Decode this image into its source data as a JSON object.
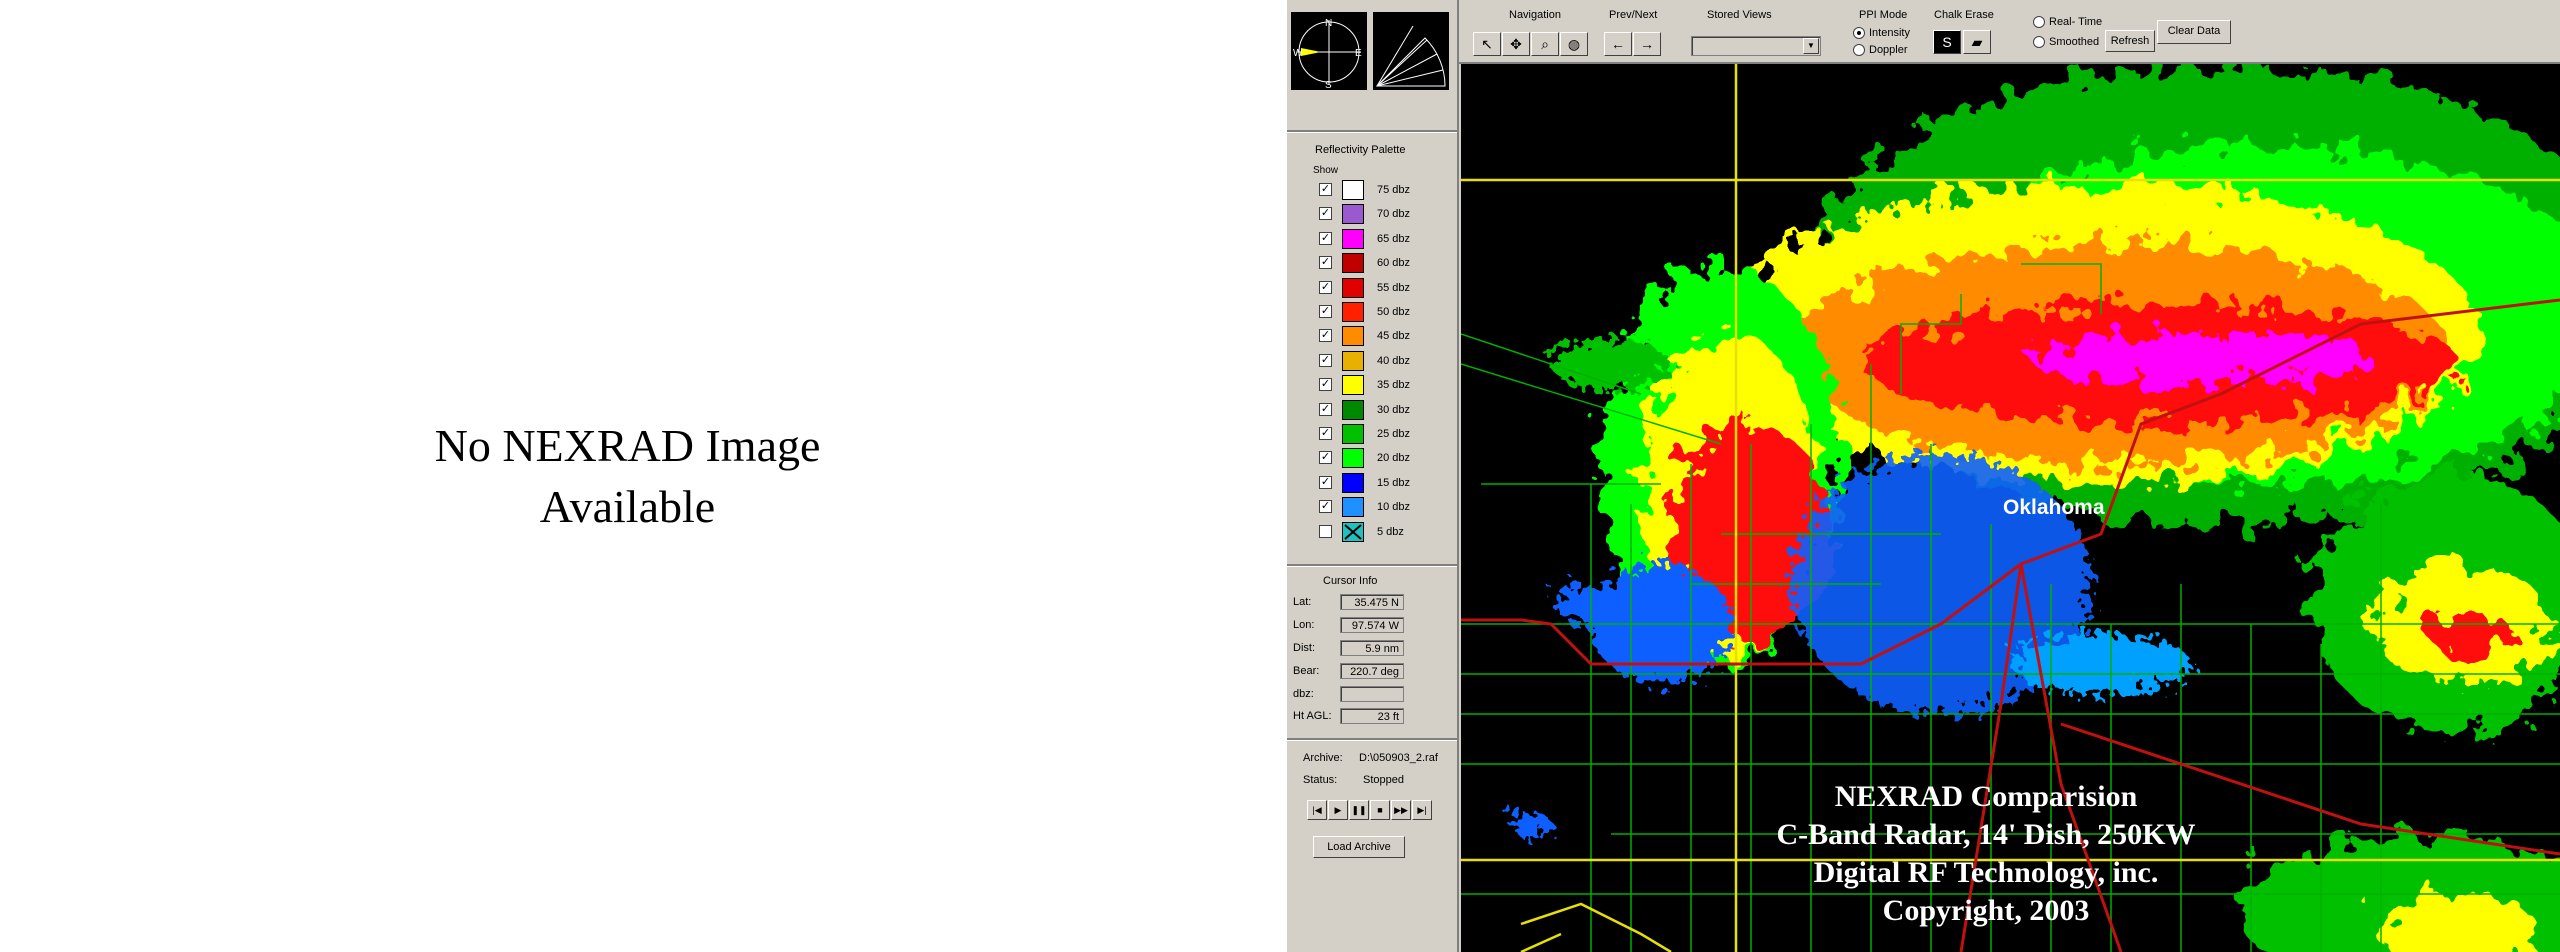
{
  "left_panel": {
    "no_image_line1": "No NEXRAD Image",
    "no_image_line2": "Available"
  },
  "compass": {
    "n": "N",
    "s": "S",
    "e": "E",
    "w": "W"
  },
  "palette": {
    "title": "Reflectivity Palette",
    "show_label": "Show",
    "items": [
      {
        "label": "75 dbz",
        "color": "#ffffff",
        "checked": true
      },
      {
        "label": "70 dbz",
        "color": "#9b59d0",
        "checked": true
      },
      {
        "label": "65 dbz",
        "color": "#ff00ff",
        "checked": true
      },
      {
        "label": "60 dbz",
        "color": "#c00000",
        "checked": true
      },
      {
        "label": "55 dbz",
        "color": "#e00000",
        "checked": true
      },
      {
        "label": "50 dbz",
        "color": "#ff2000",
        "checked": true
      },
      {
        "label": "45 dbz",
        "color": "#ff8c00",
        "checked": true
      },
      {
        "label": "40 dbz",
        "color": "#e8b000",
        "checked": true
      },
      {
        "label": "35 dbz",
        "color": "#ffff00",
        "checked": true
      },
      {
        "label": "30 dbz",
        "color": "#008800",
        "checked": true
      },
      {
        "label": "25 dbz",
        "color": "#00c000",
        "checked": true
      },
      {
        "label": "20 dbz",
        "color": "#00ff00",
        "checked": true
      },
      {
        "label": "15 dbz",
        "color": "#0000ff",
        "checked": true
      },
      {
        "label": "10 dbz",
        "color": "#1e90ff",
        "checked": true
      },
      {
        "label": "5 dbz",
        "color": "#20c0c0",
        "checked": false
      }
    ]
  },
  "cursor_info": {
    "title": "Cursor Info",
    "lat_label": "Lat:",
    "lat": "35.475 N",
    "lon_label": "Lon:",
    "lon": "97.574 W",
    "dist_label": "Dist:",
    "dist": "5.9 nm",
    "bear_label": "Bear:",
    "bear": "220.7 deg",
    "dbz_label": "dbz:",
    "dbz": "",
    "ht_label": "Ht AGL:",
    "ht": "23 ft"
  },
  "archive": {
    "archive_label": "Archive:",
    "archive_file": "D:\\050903_2.raf",
    "status_label": "Status:",
    "status": "Stopped",
    "load_button": "Load Archive"
  },
  "toolbar": {
    "navigation": "Navigation",
    "prev_next": "Prev/Next",
    "stored_views": "Stored Views",
    "ppi_mode": "PPI Mode",
    "intensity": "Intensity",
    "doppler": "Doppler",
    "chalk_erase": "Chalk Erase",
    "real_time": "Real- Time",
    "smoothed": "Smoothed",
    "refresh": "Refresh",
    "clear_data": "Clear Data"
  },
  "map": {
    "state_label": "Oklahoma",
    "caption_line1": "NEXRAD Comparision",
    "caption_line2": "C-Band Radar, 14' Dish, 250KW",
    "caption_line3": "Digital RF Technology, inc.",
    "caption_line4": "Copyright, 2003"
  }
}
